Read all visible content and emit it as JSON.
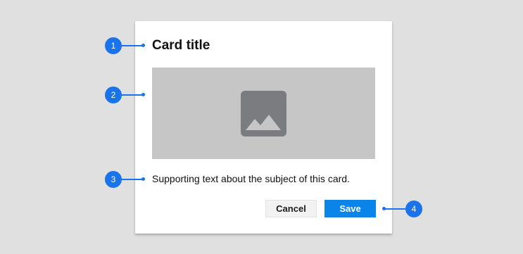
{
  "card": {
    "title": "Card title",
    "supporting_text": "Supporting text about the subject of this card.",
    "media_icon": "image-placeholder-icon",
    "actions": {
      "cancel_label": "Cancel",
      "save_label": "Save"
    }
  },
  "callouts": [
    {
      "number": "1",
      "target": "card-title"
    },
    {
      "number": "2",
      "target": "card-media"
    },
    {
      "number": "3",
      "target": "supporting-text"
    },
    {
      "number": "4",
      "target": "action-buttons"
    }
  ],
  "colors": {
    "background": "#e0e0e0",
    "card": "#ffffff",
    "media": "#c6c6c6",
    "media_icon": "#7a7c80",
    "accent": "#1a73e8",
    "save_button": "#0a84e8",
    "cancel_button": "#f2f2f2"
  }
}
